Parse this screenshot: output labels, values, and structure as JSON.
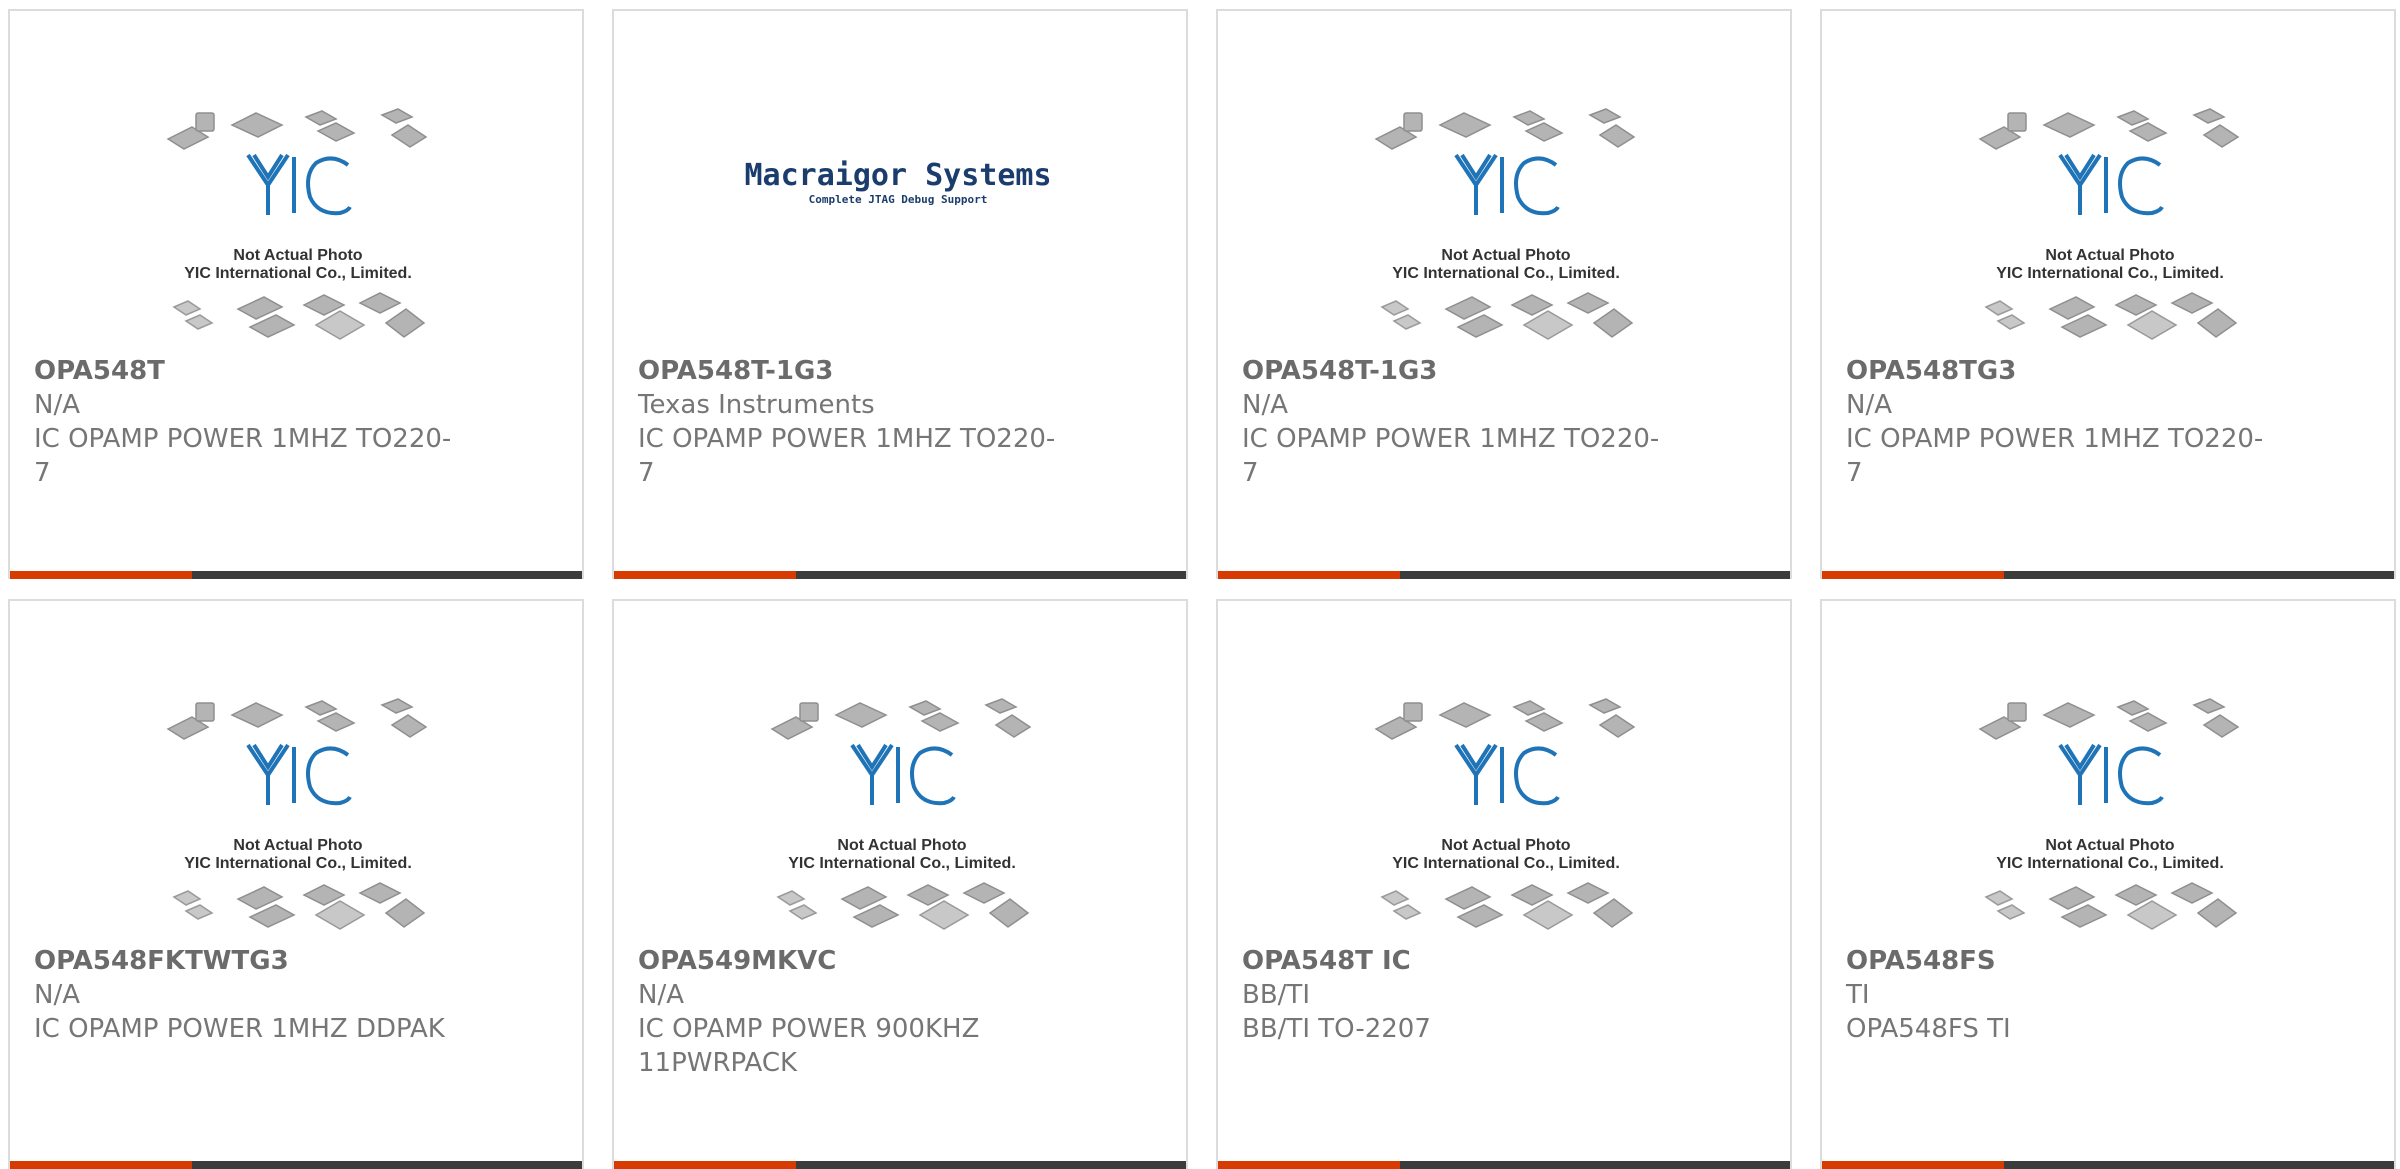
{
  "colors": {
    "accent": "#d83b01",
    "bar": "#3c3c3c",
    "border": "#dcdcdc",
    "text": "#767676",
    "yic_blue": "#1f73b7"
  },
  "placeholder": {
    "line1": "Not Actual Photo",
    "line2": "YIC International Co., Limited.",
    "logo": "YIC"
  },
  "macraigor": {
    "name": "Macraigor Systems",
    "tagline": "Complete JTAG Debug Support"
  },
  "products": [
    {
      "part": "OPA548T",
      "maker": "N/A",
      "desc": "IC OPAMP POWER 1MHZ TO220-7",
      "image": "placeholder"
    },
    {
      "part": "OPA548T-1G3",
      "maker": "Texas Instruments",
      "desc": "IC OPAMP POWER 1MHZ TO220-7",
      "image": "macraigor"
    },
    {
      "part": "OPA548T-1G3",
      "maker": "N/A",
      "desc": "IC OPAMP POWER 1MHZ TO220-7",
      "image": "placeholder"
    },
    {
      "part": "OPA548TG3",
      "maker": "N/A",
      "desc": "IC OPAMP POWER 1MHZ TO220-7",
      "image": "placeholder"
    },
    {
      "part": "OPA548FKTWTG3",
      "maker": "N/A",
      "desc": "IC OPAMP POWER 1MHZ DDPAK",
      "image": "placeholder"
    },
    {
      "part": "OPA549MKVC",
      "maker": "N/A",
      "desc": "IC OPAMP POWER 900KHZ 11PWRPACK",
      "image": "placeholder"
    },
    {
      "part": "OPA548T IC",
      "maker": "BB/TI",
      "desc": "BB/TI TO-2207",
      "image": "placeholder"
    },
    {
      "part": "OPA548FS",
      "maker": "TI",
      "desc": "OPA548FS TI",
      "image": "placeholder"
    }
  ]
}
